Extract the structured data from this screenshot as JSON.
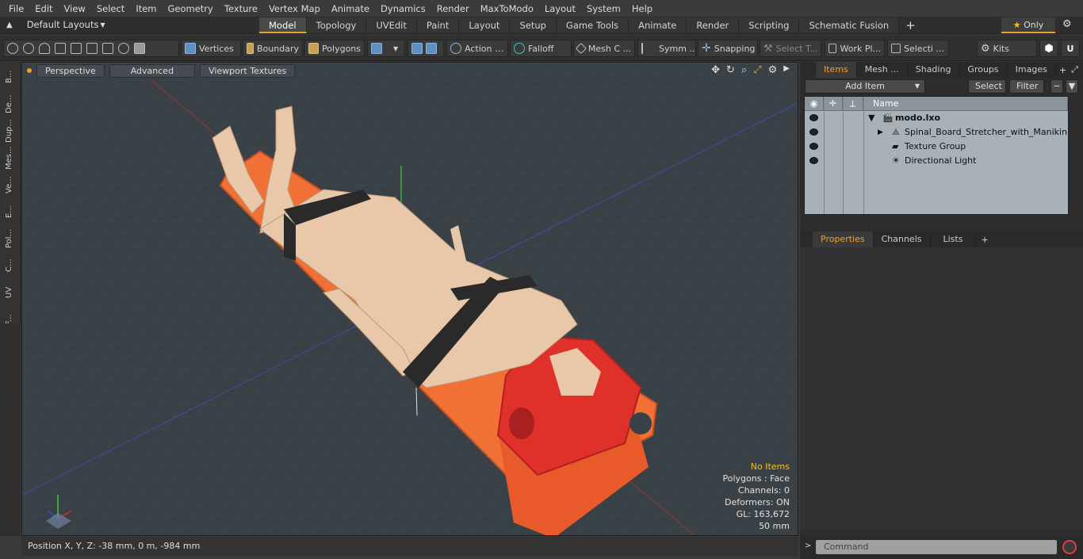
{
  "menu": [
    "File",
    "Edit",
    "View",
    "Select",
    "Item",
    "Geometry",
    "Texture",
    "Vertex Map",
    "Animate",
    "Dynamics",
    "Render",
    "MaxToModo",
    "Layout",
    "System",
    "Help"
  ],
  "layouts_label": "Default Layouts",
  "tabs": [
    "Model",
    "Topology",
    "UVEdit",
    "Paint",
    "Layout",
    "Setup",
    "Game Tools",
    "Animate",
    "Render",
    "Scripting",
    "Schematic Fusion"
  ],
  "active_tab": "Model",
  "only_label": "Only",
  "toolbar": {
    "vertices": "Vertices",
    "boundary": "Boundary",
    "polygons": "Polygons",
    "action": "Action",
    "falloff": "Falloff",
    "mesh": "Mesh C ...",
    "symm": "Symm ...",
    "snapping": "Snapping",
    "select_t": "Select T...",
    "work_pl": "Work Pl...",
    "selecti": "Selecti ...",
    "kits": "Kits"
  },
  "left_strip": [
    "B...",
    "De...",
    "Dup...",
    "Mes...",
    "Ve...",
    "E...",
    "Pol...",
    "C...",
    "UV",
    "F..."
  ],
  "viewport": {
    "perspective": "Perspective",
    "advanced": "Advanced",
    "viewport_textures": "Viewport Textures",
    "hud": {
      "no_items": "No Items",
      "polygons": "Polygons : Face",
      "channels": "Channels: 0",
      "deformers": "Deformers: ON",
      "gl": "GL: 163,672",
      "scale": "50 mm"
    }
  },
  "status": {
    "position": "Position X, Y, Z:   -38 mm, 0 m, -984 mm"
  },
  "right_panel": {
    "tabs": [
      "Items",
      "Mesh ...",
      "Shading",
      "Groups",
      "Images"
    ],
    "add_item": "Add Item",
    "select": "Select",
    "filter": "Filter",
    "name_header": "Name",
    "tree": [
      {
        "label": "modo.lxo",
        "indent": 0
      },
      {
        "label": "Spinal_Board_Stretcher_with_Manikin",
        "indent": 1
      },
      {
        "label": "Texture Group",
        "indent": 1
      },
      {
        "label": "Directional Light",
        "indent": 1
      }
    ],
    "props_tabs": [
      "Properties",
      "Channels",
      "Lists"
    ],
    "command_placeholder": "Command"
  }
}
